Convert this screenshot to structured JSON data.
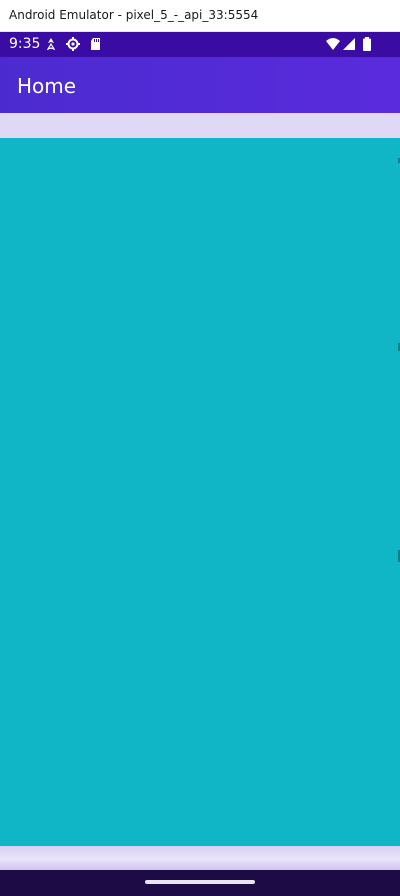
{
  "window": {
    "title": "Android Emulator - pixel_5_-_api_33:5554"
  },
  "status_bar": {
    "time": "9:35",
    "left_icons": [
      "location-icon",
      "settings-icon",
      "sd-card-icon"
    ],
    "right_icons": [
      "wifi-icon",
      "signal-icon",
      "battery-icon"
    ]
  },
  "app_bar": {
    "title": "Home"
  },
  "colors": {
    "status_bar": "#3a0ca3",
    "app_bar": "#512bd4",
    "content": "#10b5c6",
    "spacer": "#e0d9f6",
    "nav_bar": "#1c0b45"
  }
}
